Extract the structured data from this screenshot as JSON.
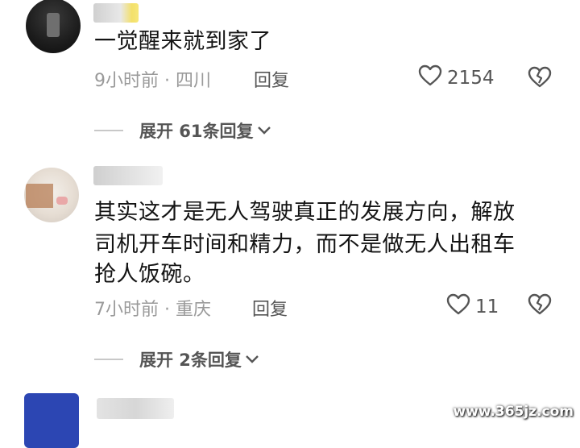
{
  "comments": [
    {
      "text": "一觉醒来就到家了",
      "meta": "9小时前 · 四川",
      "reply": "回复",
      "likes": "2154",
      "expand": "展开 61条回复"
    },
    {
      "text_lines": [
        "其实这才是无人驾驶真正的发展方向，解放",
        "司机开车时间和精力，而不是做无人出租车",
        "抢人饭碗。"
      ],
      "meta": "7小时前 · 重庆",
      "reply": "回复",
      "likes": "11",
      "expand": "展开 2条回复"
    }
  ],
  "watermark": "www.365jz.com",
  "icons": {
    "like": "heart-outline-icon",
    "dislike": "broken-heart-icon",
    "expand": "chevron-down-icon"
  },
  "colors": {
    "text": "#141414",
    "meta": "#9a9a9a"
  }
}
